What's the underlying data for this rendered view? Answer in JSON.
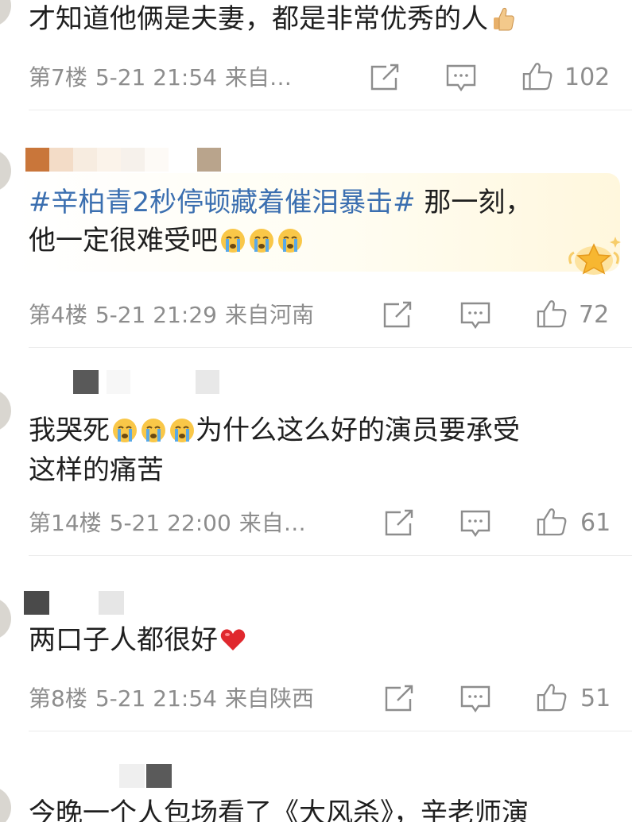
{
  "comments": [
    {
      "text": "才知道他俩是夫妻，都是非常优秀的人",
      "emoji": "thumbs-up-icon",
      "floor": "第7楼",
      "time": "5-21 21:54",
      "location": "来自…",
      "likes": "102"
    },
    {
      "hashtag": "#辛柏青2秒停顿藏着催泪暴击#",
      "text_after_hashtag": " 那一刻，",
      "text_line2": "他一定很难受吧",
      "emoji": "crying-face-icon",
      "badge": "star-badge-icon",
      "floor": "第4楼",
      "time": "5-21 21:29",
      "location": "来自河南",
      "likes": "72"
    },
    {
      "text": "我哭死",
      "text_after_emoji": "为什么这么好的演员要承受",
      "text_line2": "这样的痛苦",
      "emoji": "crying-face-icon",
      "floor": "第14楼",
      "time": "5-21 22:00",
      "location": "来自…",
      "likes": "61"
    },
    {
      "text": "两口子人都很好",
      "emoji": "red-heart-icon",
      "floor": "第8楼",
      "time": "5-21 21:54",
      "location": "来自陕西",
      "likes": "51"
    },
    {
      "text": "今晚一个人包场看了《大风杀》，辛老师演"
    }
  ],
  "colors": {
    "hashtag": "#3b6fb0",
    "meta": "#8d8d8d",
    "text": "#1f1f1f",
    "heart": "#e0282e"
  }
}
